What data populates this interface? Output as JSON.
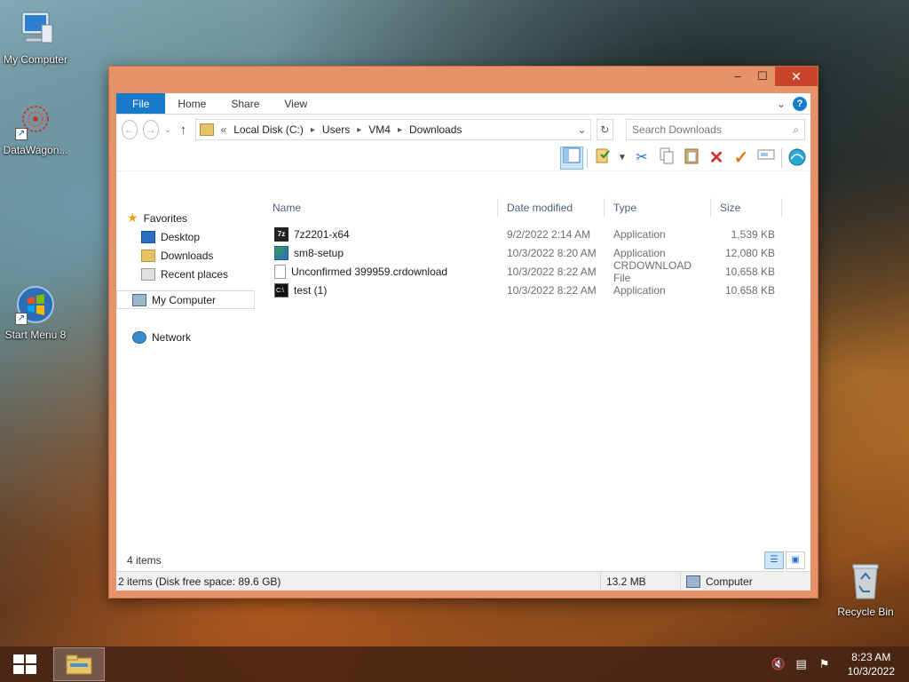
{
  "desktop": {
    "icons": [
      {
        "label": "My Computer"
      },
      {
        "label": "DataWagon..."
      },
      {
        "label": "Start Menu 8"
      },
      {
        "label": "Recycle Bin"
      }
    ]
  },
  "window": {
    "controls": {
      "minimize": "–",
      "maximize": "☐",
      "close": "✕"
    },
    "ribbon_tabs": [
      "File",
      "Home",
      "Share",
      "View"
    ],
    "ribbon_collapse": "⌄",
    "help": "?",
    "nav": {
      "back": "←",
      "forward": "→",
      "recent": "⌄",
      "up": "↑"
    },
    "address": {
      "prefix": "«",
      "crumbs": [
        "Local Disk (C:)",
        "Users",
        "VM4",
        "Downloads"
      ],
      "separator": "▸",
      "dropdown": "⌄",
      "refresh": "↻"
    },
    "search": {
      "placeholder": "Search Downloads",
      "icon": "⌕"
    },
    "columns": {
      "name": "Name",
      "date": "Date modified",
      "type": "Type",
      "size": "Size"
    },
    "sidebar": {
      "favorites": "Favorites",
      "items": [
        "Desktop",
        "Downloads",
        "Recent places"
      ],
      "computer": "My Computer",
      "network": "Network"
    },
    "files": [
      {
        "name": "7z2201-x64",
        "date": "9/2/2022 2:14 AM",
        "type": "Application",
        "size": "1,539 KB"
      },
      {
        "name": "sm8-setup",
        "date": "10/3/2022 8:20 AM",
        "type": "Application",
        "size": "12,080 KB"
      },
      {
        "name": "Unconfirmed 399959.crdownload",
        "date": "10/3/2022 8:22 AM",
        "type": "CRDOWNLOAD File",
        "size": "10,658 KB"
      },
      {
        "name": "test (1)",
        "date": "10/3/2022 8:22 AM",
        "type": "Application",
        "size": "10,658 KB"
      }
    ],
    "status": {
      "item_count": "4 items",
      "selection": "2 items (Disk free space: 89.6 GB)",
      "size": "13.2 MB",
      "location": "Computer"
    }
  },
  "taskbar": {
    "time": "8:23 AM",
    "date": "10/3/2022"
  }
}
